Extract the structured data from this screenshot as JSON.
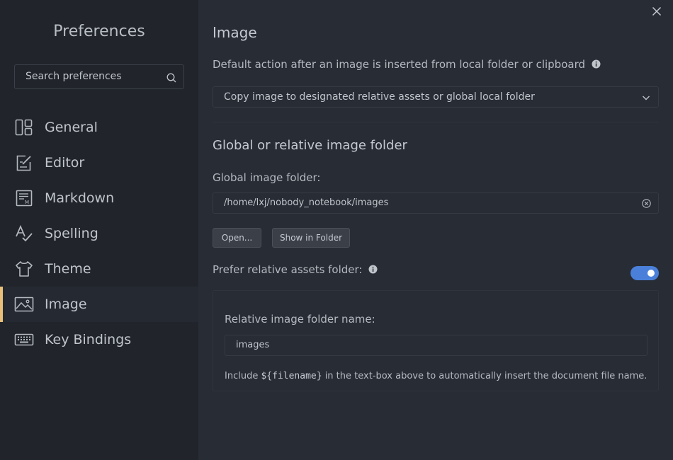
{
  "sidebar": {
    "title": "Preferences",
    "search_placeholder": "Search preferences",
    "items": [
      {
        "label": "General",
        "icon": "general-icon"
      },
      {
        "label": "Editor",
        "icon": "editor-icon"
      },
      {
        "label": "Markdown",
        "icon": "markdown-icon"
      },
      {
        "label": "Spelling",
        "icon": "spelling-icon"
      },
      {
        "label": "Theme",
        "icon": "theme-icon"
      },
      {
        "label": "Image",
        "icon": "image-icon",
        "active": true
      },
      {
        "label": "Key Bindings",
        "icon": "keyboard-icon"
      }
    ]
  },
  "main": {
    "title": "Image",
    "default_action_label": "Default action after an image is inserted from local folder or clipboard",
    "default_action_value": "Copy image to designated relative assets or global local folder",
    "folder_section_title": "Global or relative image folder",
    "global_folder_label": "Global image folder:",
    "global_folder_value": "/home/lxj/nobody_notebook/images",
    "open_button": "Open...",
    "show_in_folder_button": "Show in Folder",
    "prefer_relative_label": "Prefer relative assets folder:",
    "prefer_relative_enabled": true,
    "relative_folder_label": "Relative image folder name:",
    "relative_folder_value": "images",
    "hint_prefix": "Include ",
    "hint_code": "${filename}",
    "hint_suffix": " in the text-box above to automatically insert the document file name."
  },
  "colors": {
    "accent": "#4a80d9",
    "active_marker": "#e8c07a",
    "sidebar_bg": "#21252b",
    "main_bg": "#282c34"
  }
}
